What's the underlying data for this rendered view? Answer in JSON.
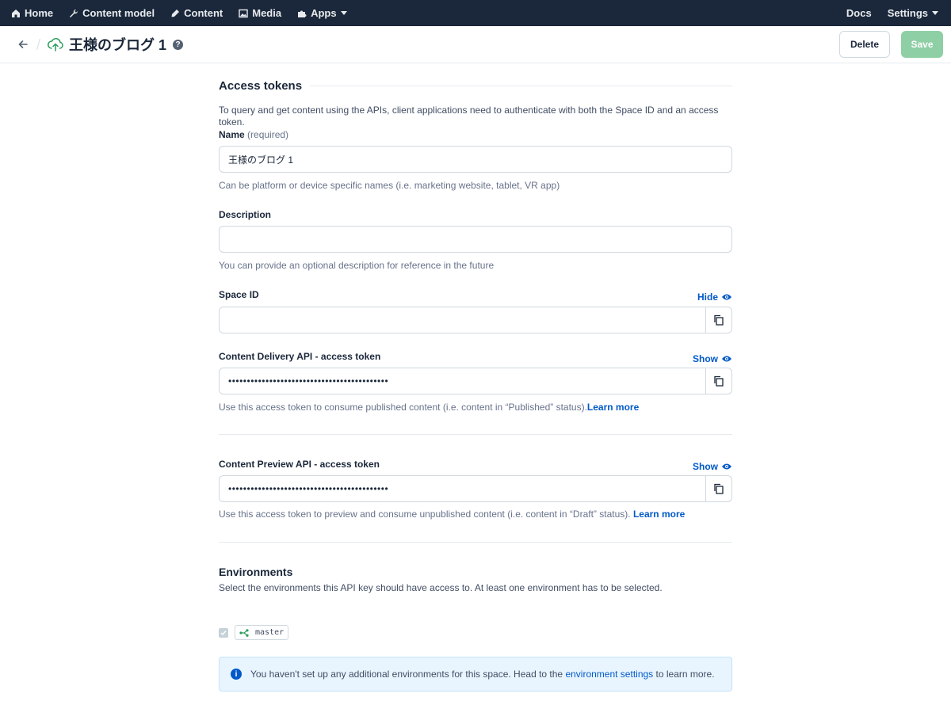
{
  "nav": {
    "left": [
      {
        "label": "Home",
        "icon": "home-icon"
      },
      {
        "label": "Content model",
        "icon": "wrench-icon"
      },
      {
        "label": "Content",
        "icon": "pen-icon"
      },
      {
        "label": "Media",
        "icon": "image-icon"
      },
      {
        "label": "Apps",
        "icon": "puzzle-icon"
      }
    ],
    "docs": "Docs",
    "settings": "Settings"
  },
  "header": {
    "title": "王様のブログ 1",
    "help": "?",
    "delete": "Delete",
    "save": "Save"
  },
  "main": {
    "title": "Access tokens",
    "intro": "To query and get content using the APIs, client applications need to authenticate with both the Space ID and an access token.",
    "name": {
      "label": "Name",
      "required": "(required)",
      "value": "王様のブログ 1",
      "help": "Can be platform or device specific names (i.e. marketing website, tablet, VR app)"
    },
    "description": {
      "label": "Description",
      "value": "",
      "help": "You can provide an optional description for reference in the future"
    },
    "space_id": {
      "label": "Space ID",
      "toggle": "Hide",
      "value": ""
    },
    "cda": {
      "label": "Content Delivery API - access token",
      "toggle": "Show",
      "value": "•••••••••••••••••••••••••••••••••••••••••••",
      "help": "Use this access token to consume published content (i.e. content in “Published” status).",
      "learn_more": "Learn more"
    },
    "cpa": {
      "label": "Content Preview API - access token",
      "toggle": "Show",
      "value": "•••••••••••••••••••••••••••••••••••••••••••",
      "help": "Use this access token to preview and consume unpublished content (i.e. content in “Draft” status). ",
      "learn_more": "Learn more"
    },
    "environments": {
      "title": "Environments",
      "help": "Select the environments this API key should have access to. At least one environment has to be selected.",
      "items": [
        {
          "name": "master",
          "checked": true
        }
      ],
      "note_prefix": "You haven't set up any additional environments for this space. Head to the ",
      "note_link": "environment settings",
      "note_suffix": " to learn more."
    }
  },
  "colors": {
    "nav_bg": "#1b273a",
    "accent": "#0059c8",
    "save_disabled": "#8fcfa5",
    "note_bg": "#e8f5ff"
  }
}
